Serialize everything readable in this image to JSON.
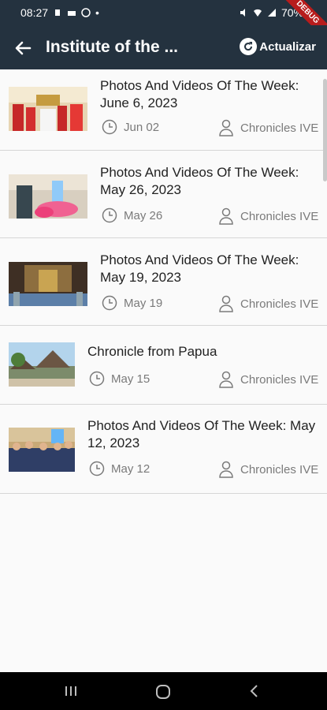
{
  "status": {
    "time": "08:27",
    "battery": "70%"
  },
  "appbar": {
    "title": "Institute of the ...",
    "refresh_label": "Actualizar"
  },
  "debug_ribbon": "DEBUG",
  "posts": [
    {
      "title": "Photos And Videos Of The Week: June 6, 2023",
      "date": "Jun 02",
      "author": "Chronicles IVE"
    },
    {
      "title": "Photos And Videos Of The Week: May 26, 2023",
      "date": "May 26",
      "author": "Chronicles IVE"
    },
    {
      "title": "Photos And Videos Of The Week: May 19, 2023",
      "date": "May 19",
      "author": "Chronicles IVE"
    },
    {
      "title": "Chronicle from Papua",
      "date": "May 15",
      "author": "Chronicles IVE"
    },
    {
      "title": "Photos And Videos Of The Week: May 12, 2023",
      "date": "May 12",
      "author": "Chronicles IVE"
    }
  ],
  "icons": {
    "back": "arrow-left-icon",
    "refresh": "refresh-icon",
    "date": "clock-icon",
    "author": "person-icon"
  }
}
